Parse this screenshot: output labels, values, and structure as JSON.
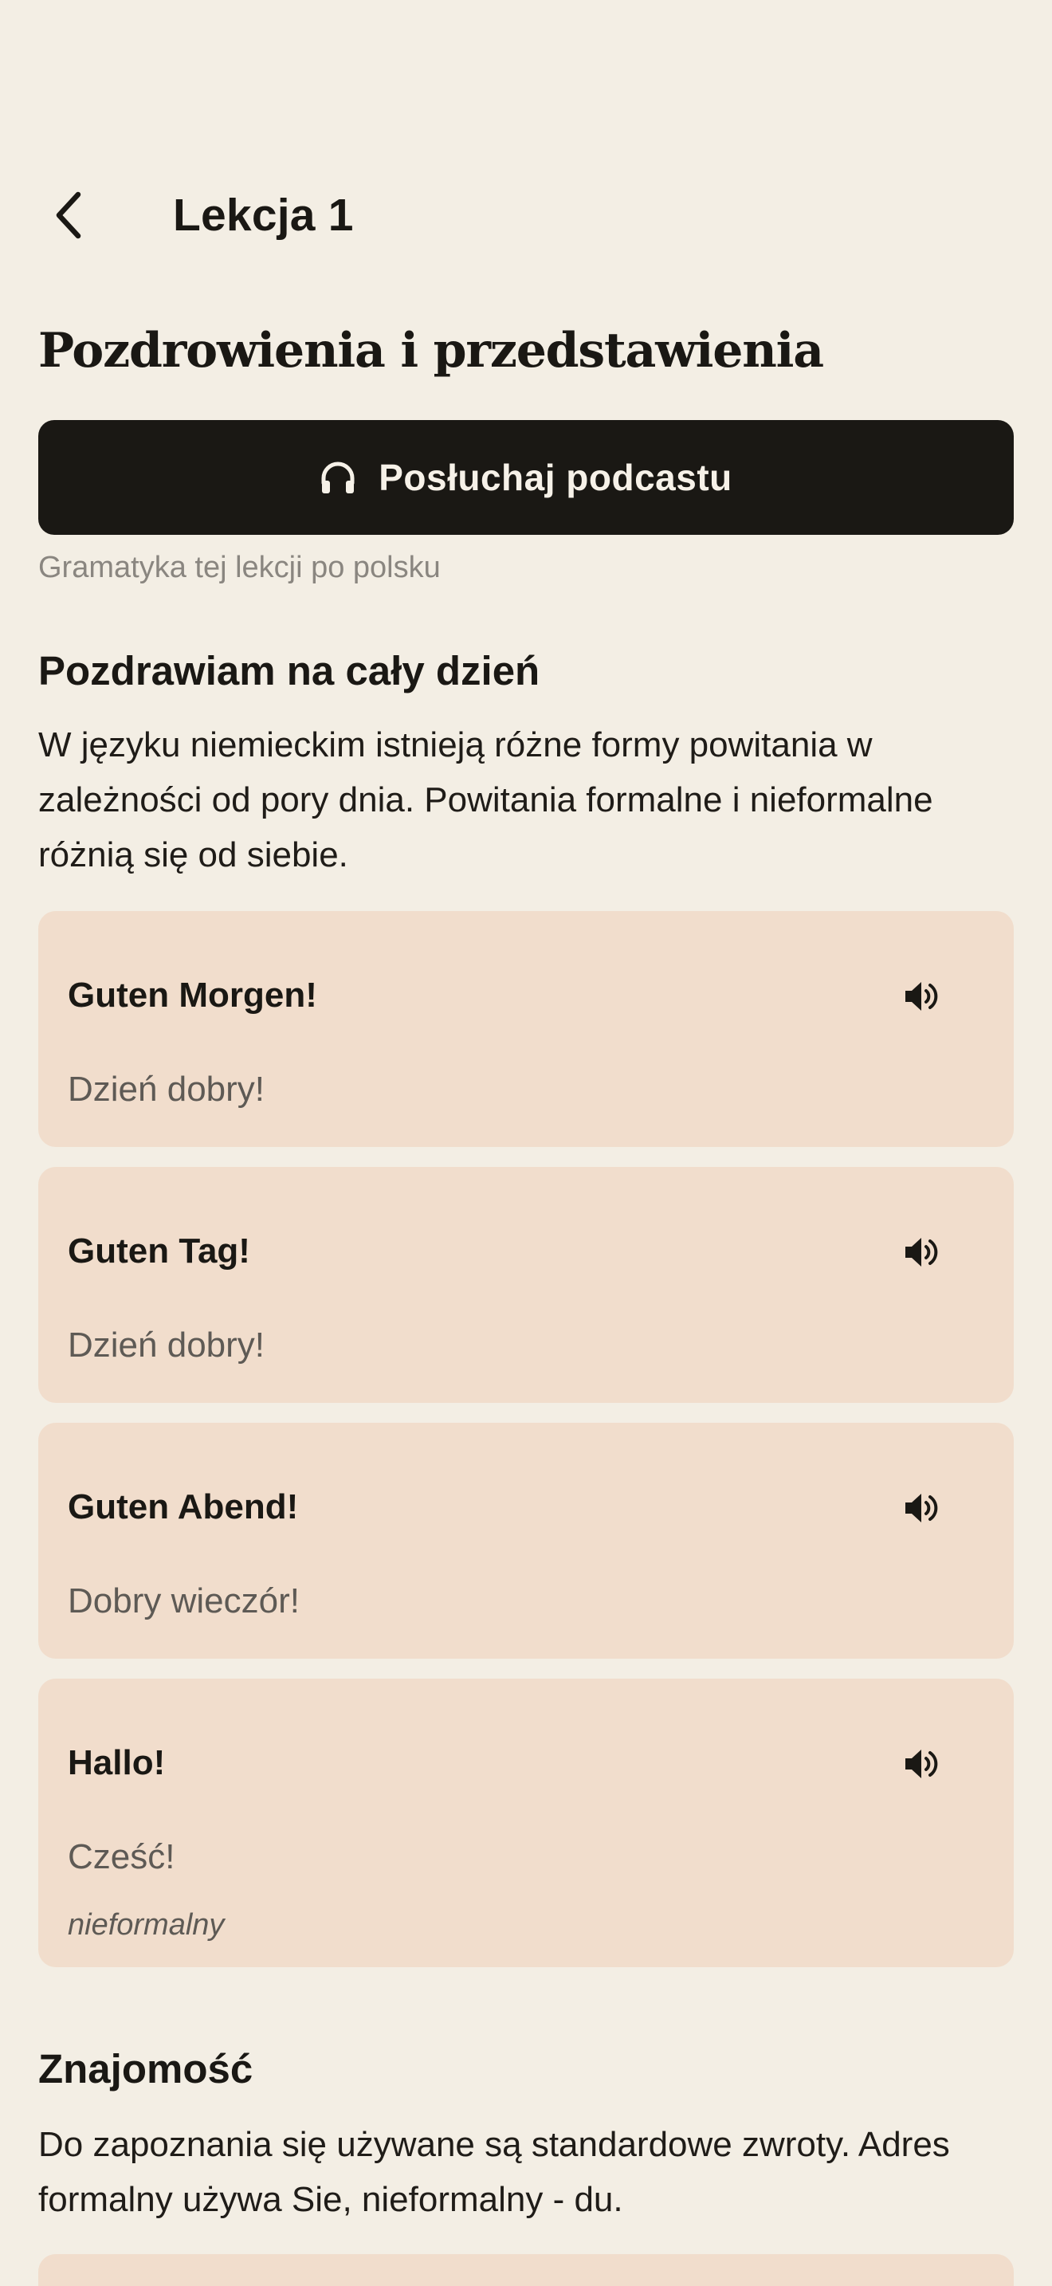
{
  "header": {
    "title": "Lekcja 1",
    "back_icon": "chevron-left-icon"
  },
  "lesson": {
    "title": "Pozdrowienia i przedstawienia",
    "podcast_button": "Posłuchaj podcastu",
    "podcast_icon": "headphones-icon",
    "grammar_link": "Gramatyka tej lekcji po polsku"
  },
  "sections": [
    {
      "title": "Pozdrawiam na cały dzień",
      "description": "W języku niemieckim istnieją różne formy powitania w zależności od pory dnia. Powitania formalne i nieformalne różnią się od siebie.",
      "phrases": [
        {
          "phrase": "Guten Morgen!",
          "translation": "Dzień dobry!",
          "note": ""
        },
        {
          "phrase": "Guten Tag!",
          "translation": "Dzień dobry!",
          "note": ""
        },
        {
          "phrase": "Guten Abend!",
          "translation": "Dobry wieczór!",
          "note": ""
        },
        {
          "phrase": "Hallo!",
          "translation": "Cześć!",
          "note": "nieformalny"
        }
      ]
    },
    {
      "title": "Znajomość",
      "description": "Do zapoznania się używane są standardowe zwroty. Adres formalny używa Sie, nieformalny - du."
    }
  ],
  "colors": {
    "background": "#f3eee4",
    "card": "#f1ddcc",
    "button": "#1a1814",
    "text": "#1a1814",
    "muted": "#8a8680"
  }
}
